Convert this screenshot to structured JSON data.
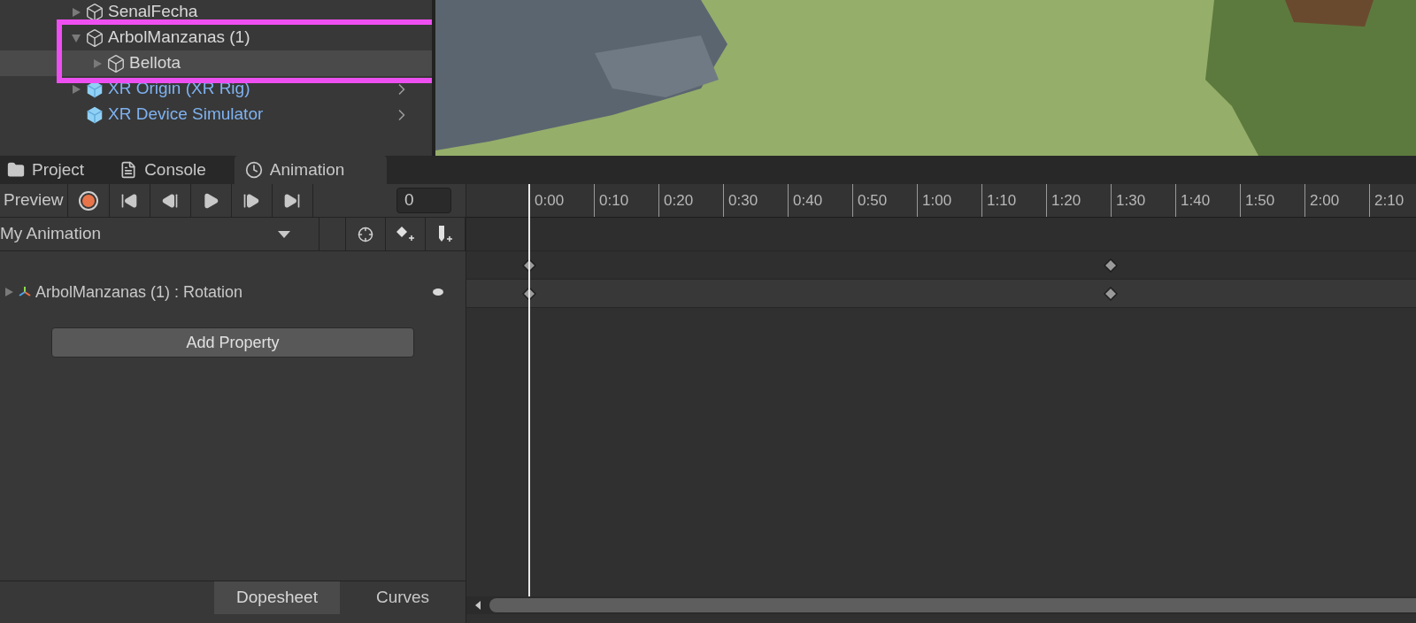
{
  "hierarchy": {
    "items": [
      {
        "name": "SenalFecha",
        "expanded": false,
        "selected": false,
        "prefab": false
      },
      {
        "name": "ArbolManzanas (1)",
        "expanded": true,
        "selected": false,
        "prefab": false,
        "children": [
          {
            "name": "Bellota",
            "expanded": false,
            "selected": true,
            "prefab": false
          }
        ]
      },
      {
        "name": "XR Origin (XR Rig)",
        "expanded": false,
        "selected": false,
        "prefab": true
      },
      {
        "name": "XR Device Simulator",
        "selected": false,
        "prefab": true
      }
    ]
  },
  "tabs": [
    {
      "label": "Project",
      "kind": "folder",
      "selected": false
    },
    {
      "label": "Console",
      "kind": "console",
      "selected": false
    },
    {
      "label": "Animation",
      "kind": "clock",
      "selected": true
    }
  ],
  "animation": {
    "preview_label": "Preview",
    "recording": false,
    "frame": "0",
    "clip": "My Animation",
    "properties": [
      {
        "name": "ArbolManzanas (1) : Rotation",
        "expanded": false
      }
    ],
    "add_property": "Add Property",
    "views": [
      {
        "label": "Dopesheet",
        "selected": true
      },
      {
        "label": "Curves",
        "selected": false
      }
    ],
    "ticks": [
      {
        "label": "0:00",
        "keyframe": true
      },
      {
        "label": "0:10",
        "keyframe": false
      },
      {
        "label": "0:20",
        "keyframe": false
      },
      {
        "label": "0:30",
        "keyframe": false
      },
      {
        "label": "0:40",
        "keyframe": false
      },
      {
        "label": "0:50",
        "keyframe": false
      },
      {
        "label": "1:00",
        "keyframe": false
      },
      {
        "label": "1:10",
        "keyframe": false
      },
      {
        "label": "1:20",
        "keyframe": false
      },
      {
        "label": "1:30",
        "keyframe": true
      },
      {
        "label": "1:40",
        "keyframe": false
      },
      {
        "label": "1:50",
        "keyframe": false
      },
      {
        "label": "2:00",
        "keyframe": false
      },
      {
        "label": "2:10",
        "keyframe": false
      }
    ]
  }
}
